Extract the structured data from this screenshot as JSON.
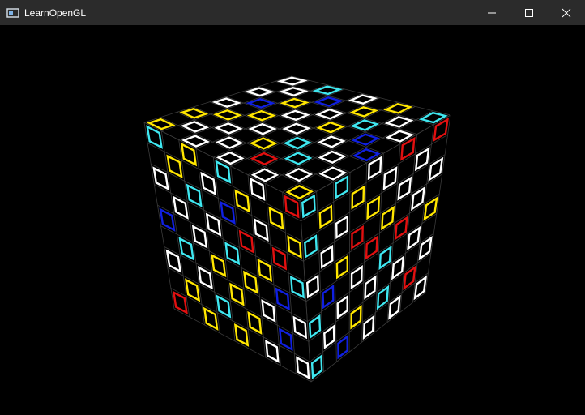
{
  "window": {
    "title": "LearnOpenGL",
    "controls": {
      "minimize_icon": "minimize-icon",
      "maximize_icon": "maximize-icon",
      "close_icon": "close-icon"
    }
  },
  "scene": {
    "description_icon": "rubik-style wireframe cube",
    "grid_size": 9,
    "colors": {
      "background": "#000000",
      "white": "#ffffff",
      "cyan": "#3fe7f0",
      "yellow": "#ffe600",
      "red": "#e01010",
      "blue": "#1020e0",
      "dark_edge": "#3a3a3a"
    }
  }
}
